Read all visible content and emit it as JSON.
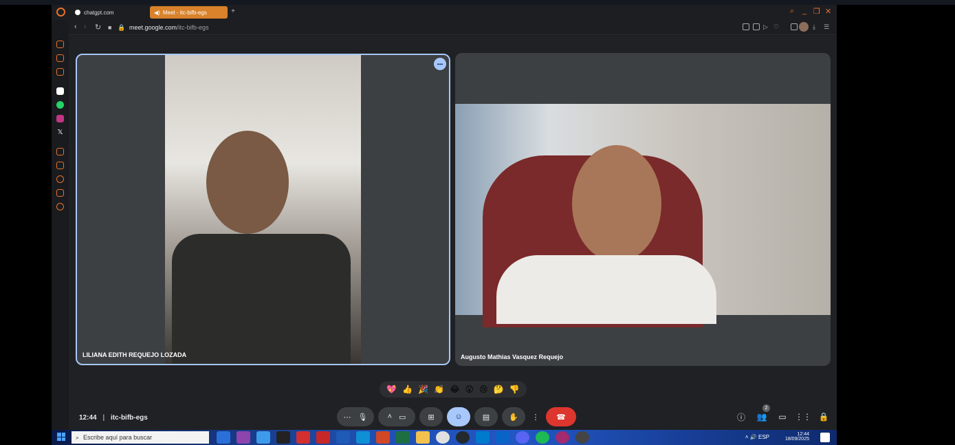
{
  "browser": {
    "tabs": [
      {
        "title": "chatgpt.com"
      },
      {
        "title": "Meet - itc-bifb-egs"
      }
    ],
    "url_prefix": "meet.google.com",
    "url_path": "/itc-bifb-egs"
  },
  "meeting": {
    "time": "12:44",
    "code": "itc-bifb-egs",
    "participants": [
      {
        "name": "LILIANA EDITH REQUEJO LOZADA",
        "speaking": true
      },
      {
        "name": "Augusto Mathias Vasquez Requejo",
        "speaking": false
      }
    ],
    "participant_count": "2",
    "reactions": [
      "💖",
      "👍",
      "🎉",
      "👏",
      "😂",
      "😮",
      "😢",
      "🤔",
      "👎"
    ]
  },
  "taskbar": {
    "search_placeholder": "Escribe aquí para buscar",
    "language": "ESP",
    "clock_time": "12:44",
    "clock_date": "18/09/2025"
  },
  "colors": {
    "accent": "#e8722a",
    "meet_bg": "#202124",
    "tile_bg": "#3c4043",
    "active_blue": "#a8c7fa",
    "hangup_red": "#dc362e"
  }
}
